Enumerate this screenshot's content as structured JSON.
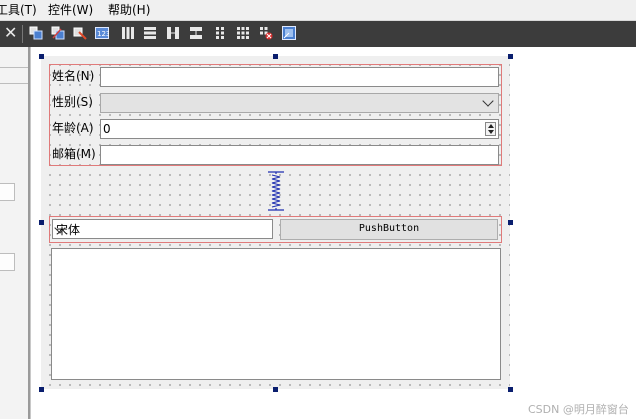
{
  "menubar": {
    "items": [
      "工具(T)",
      "控件(W)",
      "帮助(H)"
    ]
  },
  "toolbar": {
    "close_glyph": "✕",
    "icons": [
      "edit-widgets-icon",
      "edit-signals-icon",
      "edit-buddies-icon",
      "edit-tab-order-icon",
      "layout-horizontal-icon",
      "layout-vertical-icon",
      "layout-h-splitter-icon",
      "layout-v-splitter-icon",
      "layout-form-icon",
      "layout-grid-icon",
      "break-layout-icon",
      "adjust-size-icon"
    ]
  },
  "form": {
    "name_label": "姓名(N)",
    "gender_label": "性别(S)",
    "age_label": "年龄(A)",
    "age_value": "0",
    "email_label": "邮箱(M)",
    "font_combo_value": "宋体",
    "push_button_label": "PushButton"
  },
  "watermark": "CSDN @明月醉窗台",
  "colors": {
    "toolbar_bg": "#3c3c3c",
    "layout_border": "#e07a7a",
    "selection_handle": "#0a1e6e",
    "spacer": "#1f2fb0"
  }
}
